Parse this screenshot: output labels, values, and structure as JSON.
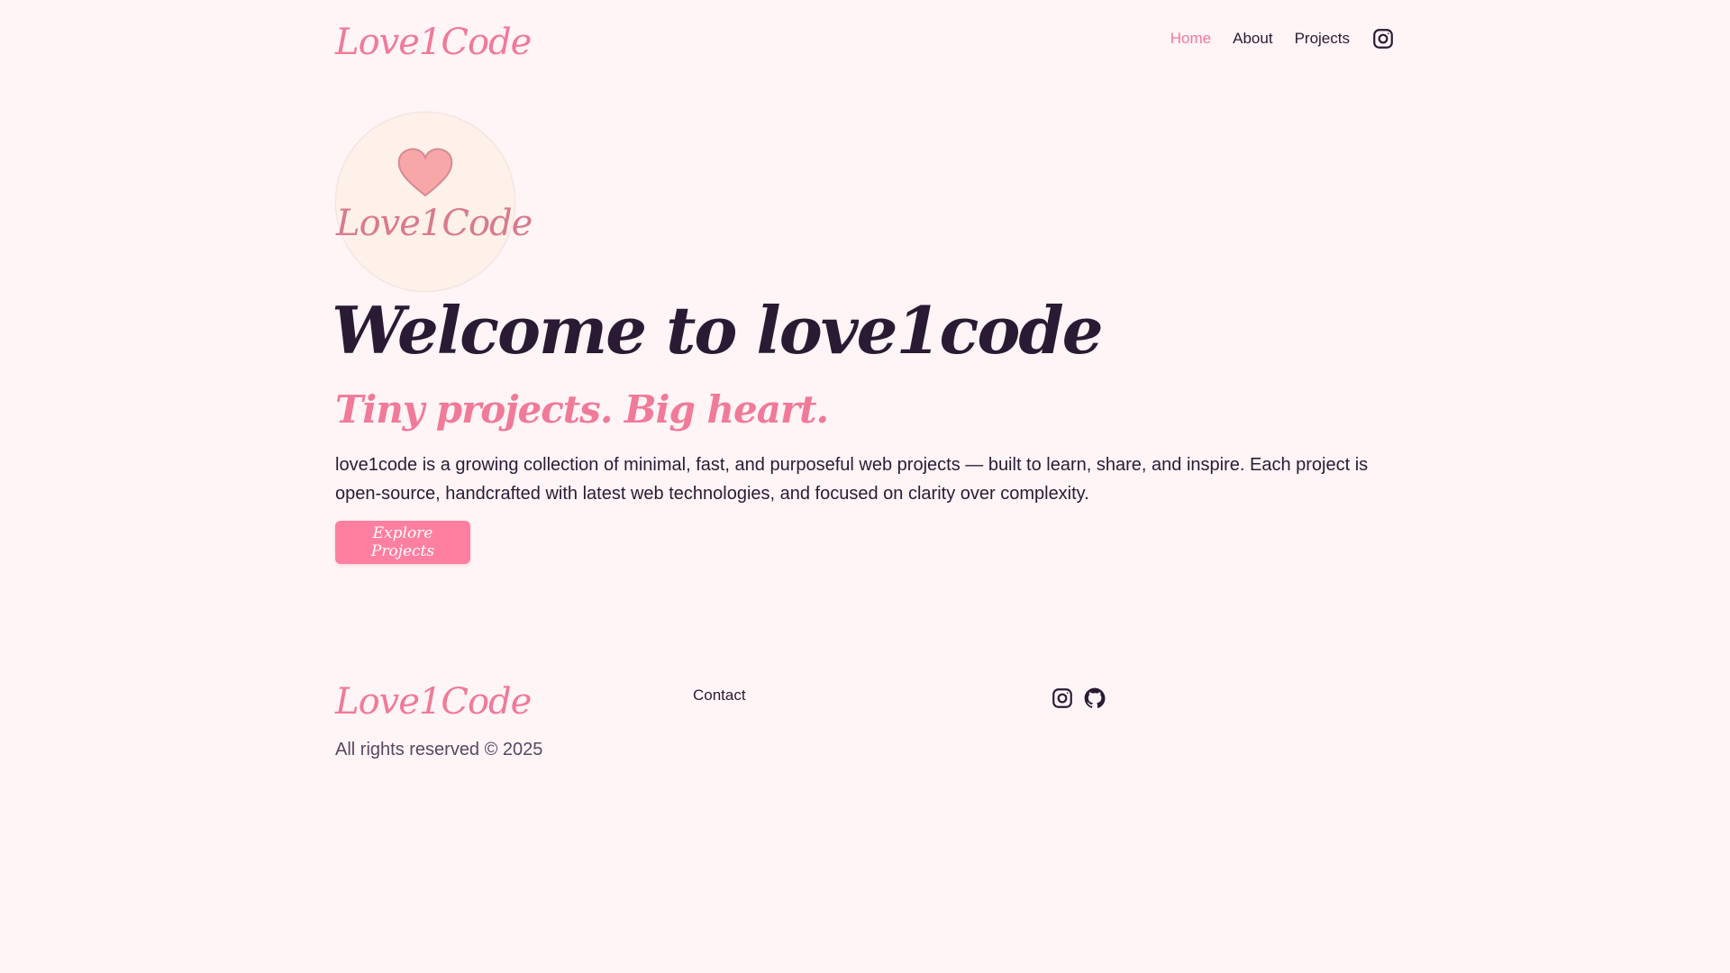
{
  "header": {
    "logo": "Love1Code",
    "nav": [
      {
        "label": "Home",
        "active": true
      },
      {
        "label": "About",
        "active": false
      },
      {
        "label": "Projects",
        "active": false
      }
    ],
    "social_icon": "instagram-icon"
  },
  "hero": {
    "avatar_label": "Love1Code",
    "title": "Welcome to love1code",
    "subtitle": "Tiny projects. Big heart.",
    "description": "love1code is a growing collection of minimal, fast, and purposeful web projects — built to learn, share, and inspire. Each project is open-source, handcrafted with latest web technologies, and focused on clarity over complexity.",
    "cta_label": "Explore Projects"
  },
  "footer": {
    "logo": "Love1Code",
    "copyright": "All rights reserved © 2025",
    "contact_label": "Contact",
    "social_icons": [
      "instagram-icon",
      "github-icon"
    ]
  },
  "colors": {
    "background": "#fff4f6",
    "accent": "#f07a98",
    "button": "#ff7fa0",
    "text": "#2b1a33"
  }
}
